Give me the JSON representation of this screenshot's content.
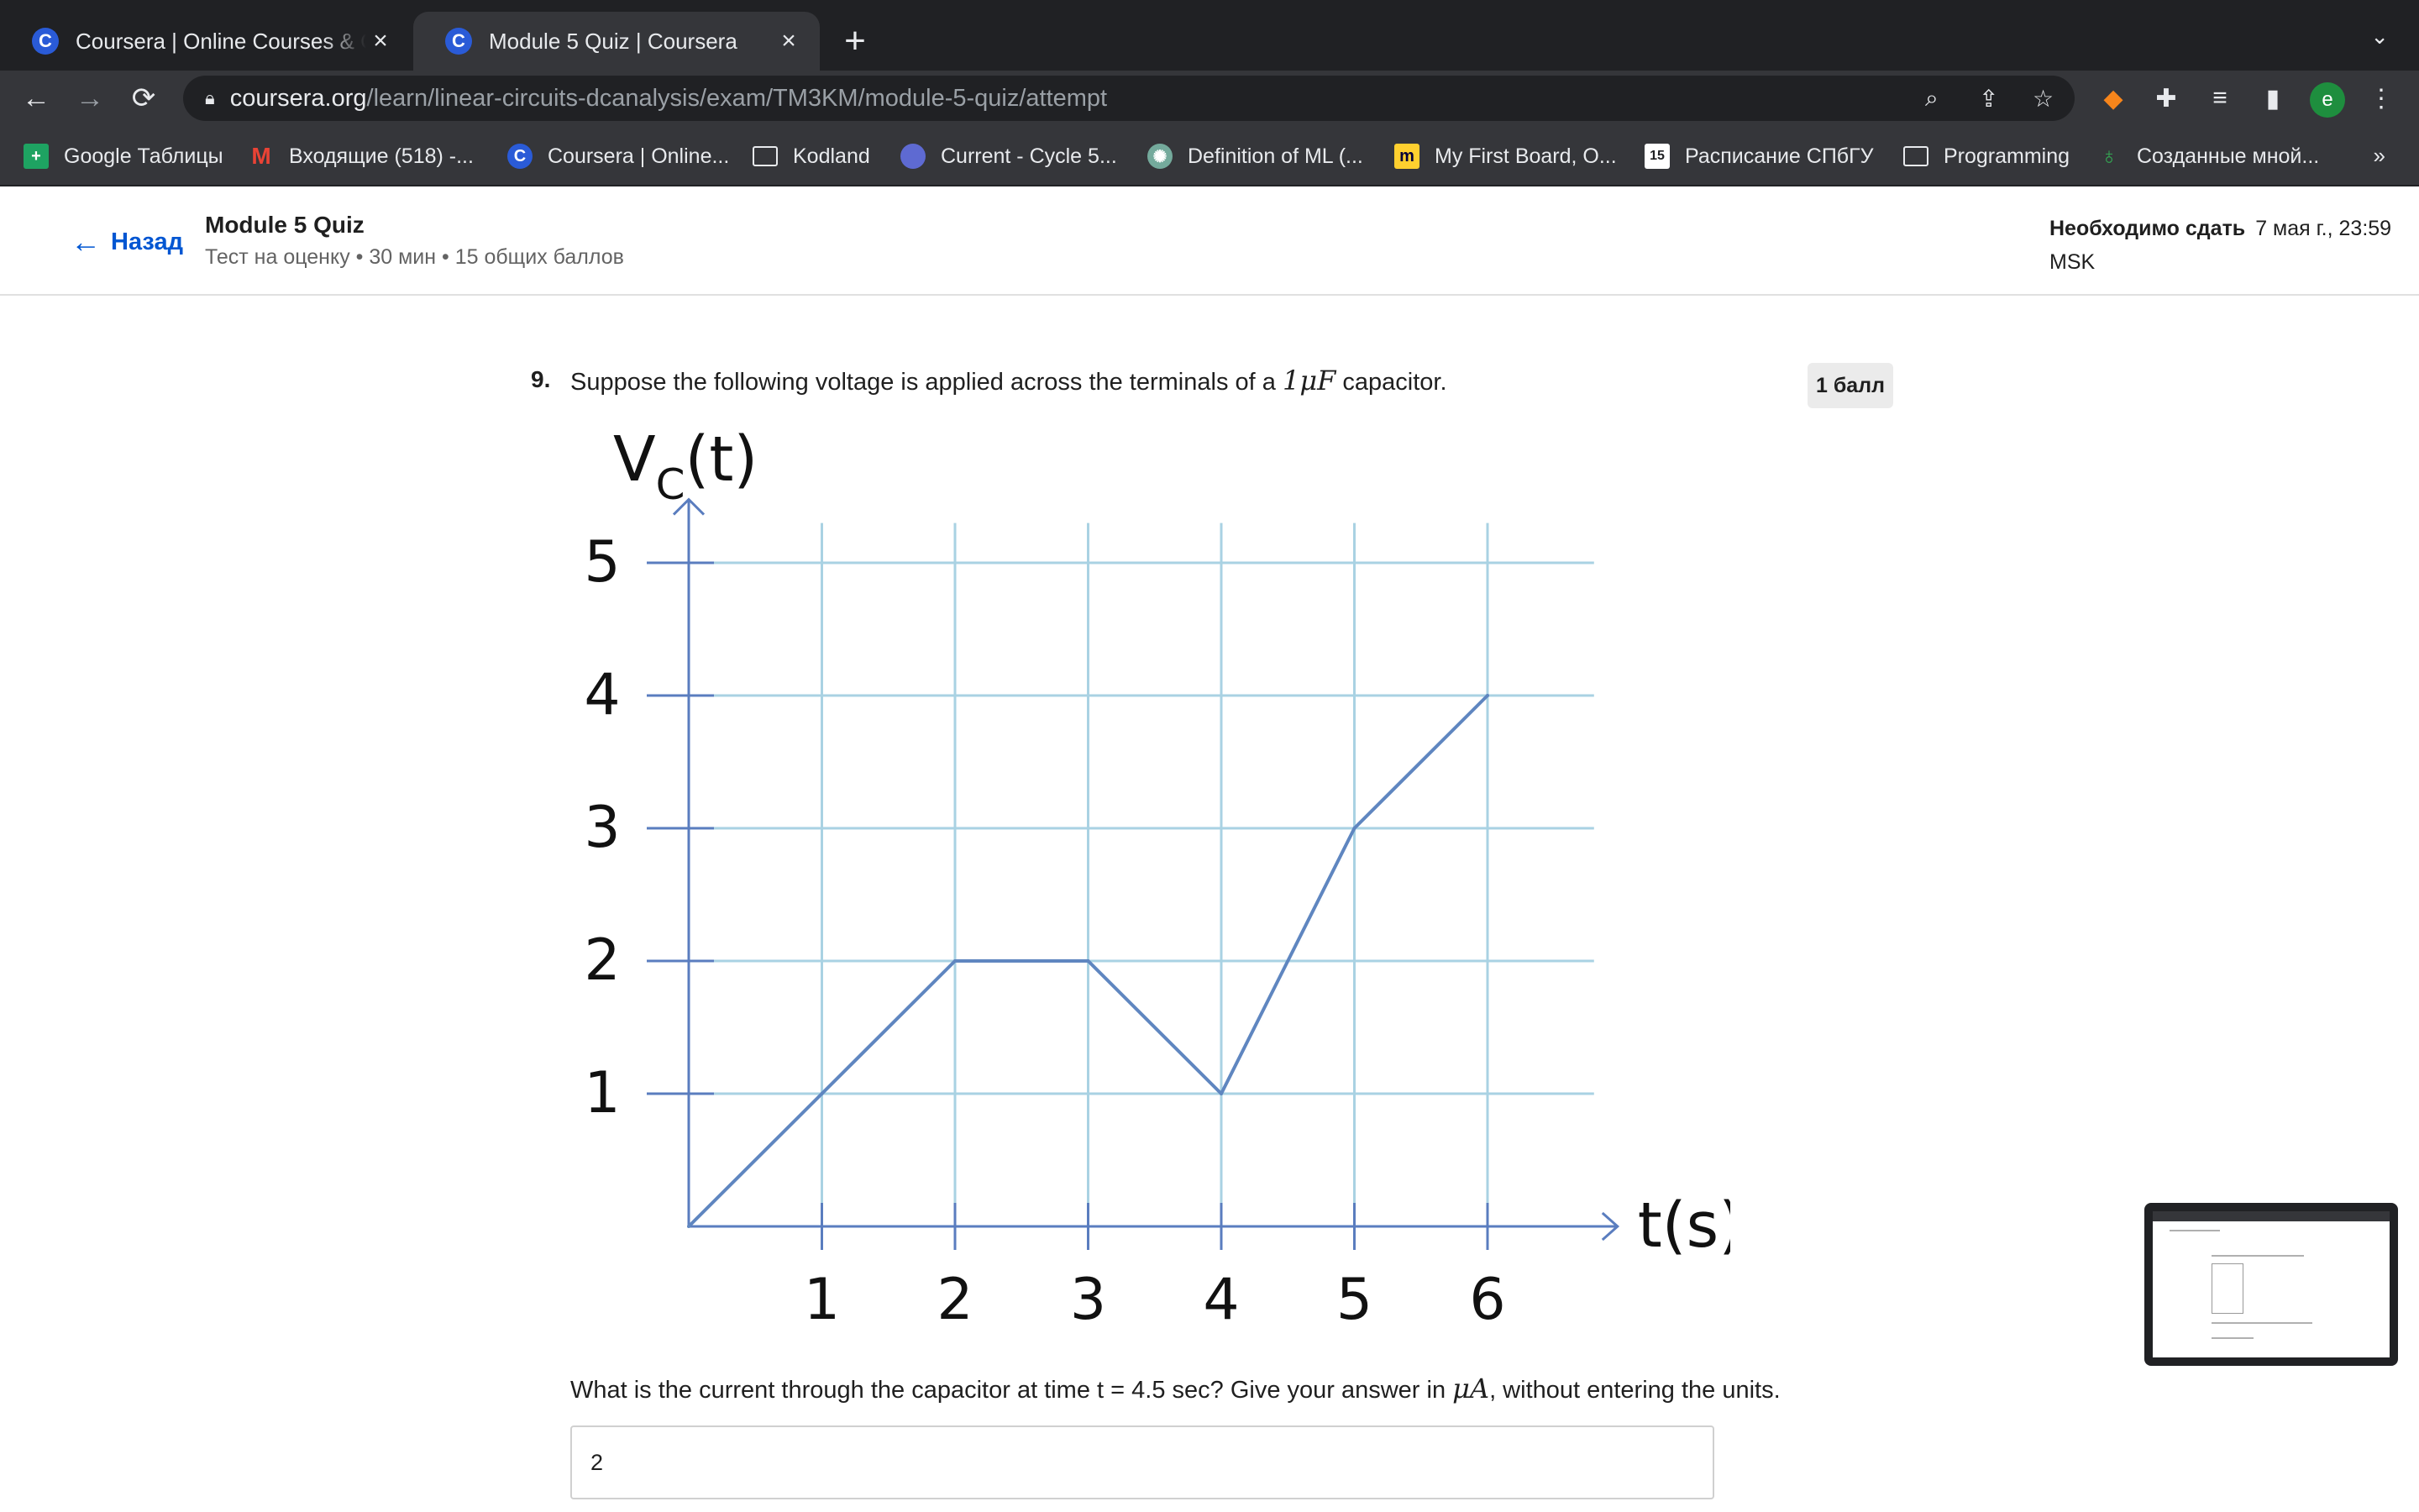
{
  "browser": {
    "tabs": [
      {
        "title": "Coursera | Online Courses & Credentials",
        "favicon": "C",
        "active": false
      },
      {
        "title": "Module 5 Quiz | Coursera",
        "favicon": "C",
        "active": true
      }
    ],
    "url_host": "coursera.org",
    "url_path": "/learn/linear-circuits-dcanalysis/exam/TM3KM/module-5-quiz/attempt",
    "profile_initial": "e",
    "bookmarks": [
      {
        "label": "Google Таблицы",
        "icon": "sheets-icon"
      },
      {
        "label": "Входящие (518) -...",
        "icon": "gmail-icon"
      },
      {
        "label": "Coursera | Online...",
        "icon": "coursera-icon"
      },
      {
        "label": "Kodland",
        "icon": "folder-icon"
      },
      {
        "label": "Current - Cycle 5...",
        "icon": "linear-icon"
      },
      {
        "label": "Definition of ML (...",
        "icon": "openai-icon"
      },
      {
        "label": "My First Board, O...",
        "icon": "miro-icon"
      },
      {
        "label": "Расписание СПбГУ",
        "icon": "calendar-icon"
      },
      {
        "label": "Programming",
        "icon": "folder-icon"
      },
      {
        "label": "Созданные мной...",
        "icon": "leaf-icon"
      }
    ]
  },
  "header": {
    "back_label": "Назад",
    "quiz_title": "Module 5 Quiz",
    "quiz_meta": "Тест на оценку • 30 мин • 15 общих баллов",
    "due_label": "Необходимо сдать",
    "due_date": "7 мая г., 23:59",
    "due_tz": "MSK"
  },
  "question": {
    "number": "9.",
    "text_before": "Suppose the following voltage is applied across the terminals of a ",
    "math": "1μF",
    "text_after": " capacitor.",
    "points": "1 балл",
    "prompt_before": "What is the current through the capacitor at time t = 4.5 sec? Give your answer in ",
    "prompt_math": "μA",
    "prompt_after": ", without entering the units.",
    "answer_value": "2"
  },
  "chart_data": {
    "type": "line",
    "ylabel_main": "V",
    "ylabel_sub": "C",
    "ylabel_tail": "(t)",
    "xlabel": "t(s)",
    "x_ticks": [
      "1",
      "2",
      "3",
      "4",
      "5",
      "6"
    ],
    "y_ticks": [
      "1",
      "2",
      "3",
      "4",
      "5"
    ],
    "xlim": [
      0,
      6.8
    ],
    "ylim": [
      0,
      5.3
    ],
    "grid": true,
    "series": [
      {
        "x": [
          0,
          1,
          2,
          3,
          4,
          5,
          6
        ],
        "y": [
          0,
          1,
          2,
          2,
          1,
          3,
          4
        ]
      }
    ],
    "colors": {
      "grid": "#a9d2e3",
      "axis": "#5a7dbf",
      "line": "#5f86c0",
      "text": "#111111"
    }
  }
}
